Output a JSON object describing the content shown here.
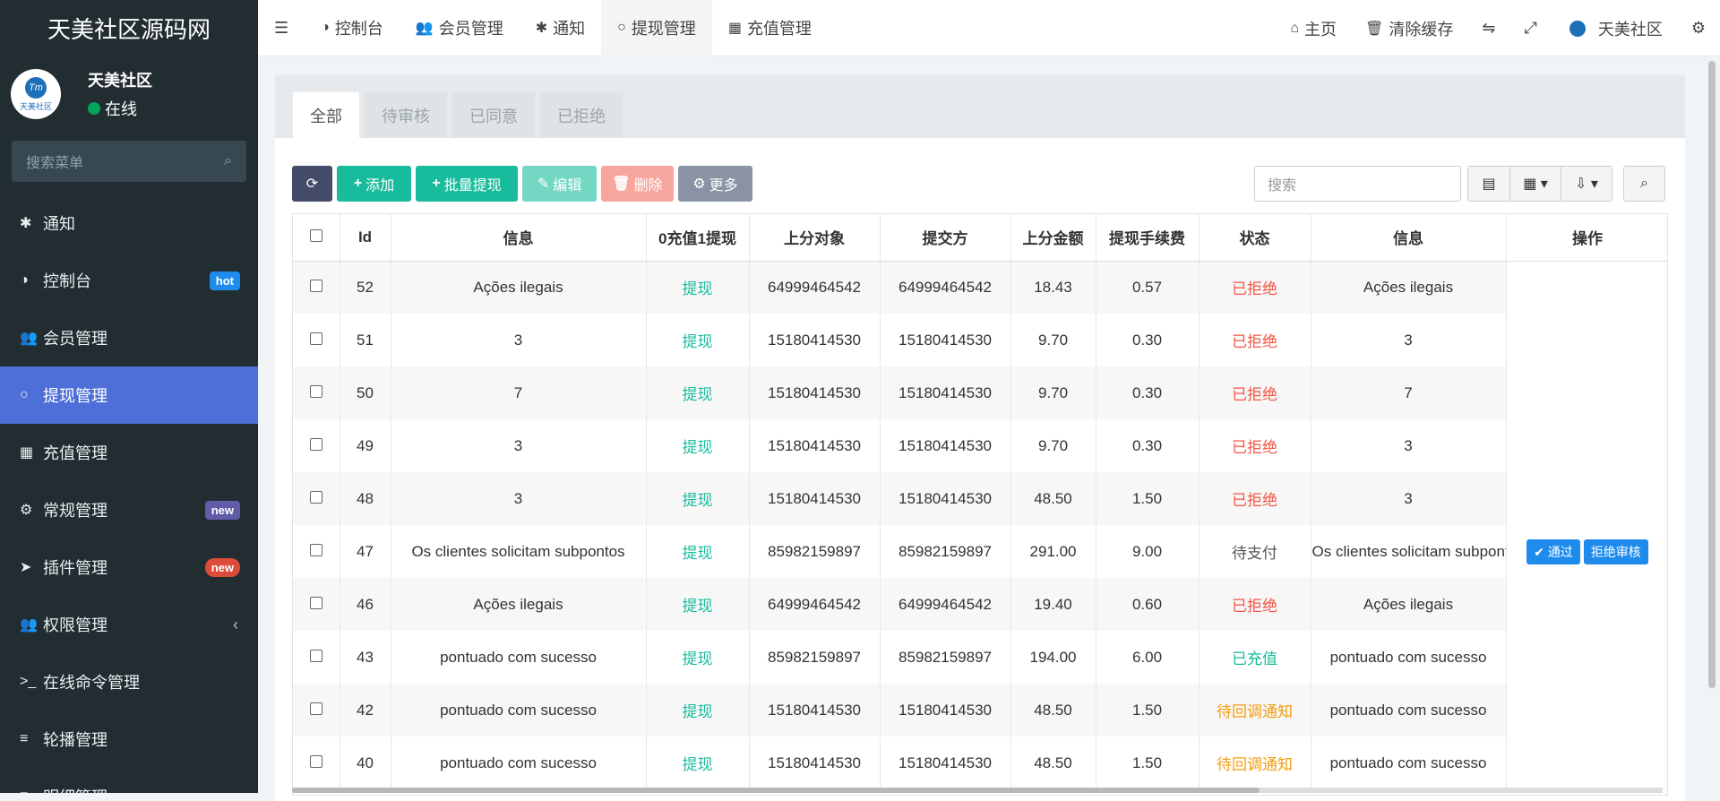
{
  "sidebar": {
    "brand": "天美社区源码网",
    "avatar_label": "天美社区",
    "user_name": "天美社区",
    "user_status": "在线",
    "search_placeholder": "搜索菜单",
    "items": [
      {
        "label": "通知",
        "icon": "✱"
      },
      {
        "label": "控制台",
        "icon": "◑",
        "badge": "hot"
      },
      {
        "label": "会员管理",
        "icon": "👥"
      },
      {
        "label": "提现管理",
        "icon": "○"
      },
      {
        "label": "充值管理",
        "icon": "▦"
      },
      {
        "label": "常规管理",
        "icon": "⚙",
        "badge": "new"
      },
      {
        "label": "插件管理",
        "icon": "➤",
        "badge": "new"
      },
      {
        "label": "权限管理",
        "icon": "👥"
      },
      {
        "label": "在线命令管理",
        "icon": ">_"
      },
      {
        "label": "轮播管理",
        "icon": "≡"
      },
      {
        "label": "明细管理",
        "icon": "≡"
      }
    ]
  },
  "topnav": {
    "tabs": [
      {
        "label": "控制台",
        "icon": "◑"
      },
      {
        "label": "会员管理",
        "icon": "👥"
      },
      {
        "label": "通知",
        "icon": "✱"
      },
      {
        "label": "提现管理",
        "icon": "○"
      },
      {
        "label": "充值管理",
        "icon": "▦"
      }
    ],
    "home": "主页",
    "clear_cache": "清除缓存",
    "user": "天美社区"
  },
  "filter_tabs": [
    "全部",
    "待审核",
    "已同意",
    "已拒绝"
  ],
  "toolbar": {
    "refresh_icon": "⟳",
    "add": "添加",
    "batch": "批量提现",
    "edit": "编辑",
    "delete": "删除",
    "more": "更多",
    "search_placeholder": "搜索"
  },
  "table": {
    "headers": [
      "Id",
      "信息",
      "0充值1提现",
      "上分对象",
      "提交方",
      "上分金额",
      "提现手续费",
      "状态",
      "信息",
      "操作"
    ],
    "rows": [
      {
        "id": "52",
        "info": "Ações ilegais",
        "type": "提现",
        "target": "64999464542",
        "submitter": "64999464542",
        "amount": "18.43",
        "fee": "0.57",
        "status": "已拒绝",
        "info2": "Ações ilegais"
      },
      {
        "id": "51",
        "info": "3",
        "type": "提现",
        "target": "15180414530",
        "submitter": "15180414530",
        "amount": "9.70",
        "fee": "0.30",
        "status": "已拒绝",
        "info2": "3"
      },
      {
        "id": "50",
        "info": "7",
        "type": "提现",
        "target": "15180414530",
        "submitter": "15180414530",
        "amount": "9.70",
        "fee": "0.30",
        "status": "已拒绝",
        "info2": "7"
      },
      {
        "id": "49",
        "info": "3",
        "type": "提现",
        "target": "15180414530",
        "submitter": "15180414530",
        "amount": "9.70",
        "fee": "0.30",
        "status": "已拒绝",
        "info2": "3"
      },
      {
        "id": "48",
        "info": "3",
        "type": "提现",
        "target": "15180414530",
        "submitter": "15180414530",
        "amount": "48.50",
        "fee": "1.50",
        "status": "已拒绝",
        "info2": "3"
      },
      {
        "id": "47",
        "info": "Os clientes solicitam subpontos",
        "type": "提现",
        "target": "85982159897",
        "submitter": "85982159897",
        "amount": "291.00",
        "fee": "9.00",
        "status": "待支付",
        "info2": "Os clientes solicitam subpontos",
        "actions": [
          "通过",
          "拒绝审核"
        ]
      },
      {
        "id": "46",
        "info": "Ações ilegais",
        "type": "提现",
        "target": "64999464542",
        "submitter": "64999464542",
        "amount": "19.40",
        "fee": "0.60",
        "status": "已拒绝",
        "info2": "Ações ilegais"
      },
      {
        "id": "43",
        "info": "pontuado com sucesso",
        "type": "提现",
        "target": "85982159897",
        "submitter": "85982159897",
        "amount": "194.00",
        "fee": "6.00",
        "status": "已充值",
        "info2": "pontuado com sucesso"
      },
      {
        "id": "42",
        "info": "pontuado com sucesso",
        "type": "提现",
        "target": "15180414530",
        "submitter": "15180414530",
        "amount": "48.50",
        "fee": "1.50",
        "status": "待回调通知",
        "info2": "pontuado com sucesso"
      },
      {
        "id": "40",
        "info": "pontuado com sucesso",
        "type": "提现",
        "target": "15180414530",
        "submitter": "15180414530",
        "amount": "48.50",
        "fee": "1.50",
        "status": "待回调通知",
        "info2": "pontuado com sucesso"
      }
    ]
  },
  "colors": {
    "sidebar_bg": "#222d32",
    "active_menu": "#4f6fd8",
    "primary": "#1f8ced",
    "success": "#18bc9c",
    "danger": "#f75444",
    "warning": "#f39c12"
  }
}
